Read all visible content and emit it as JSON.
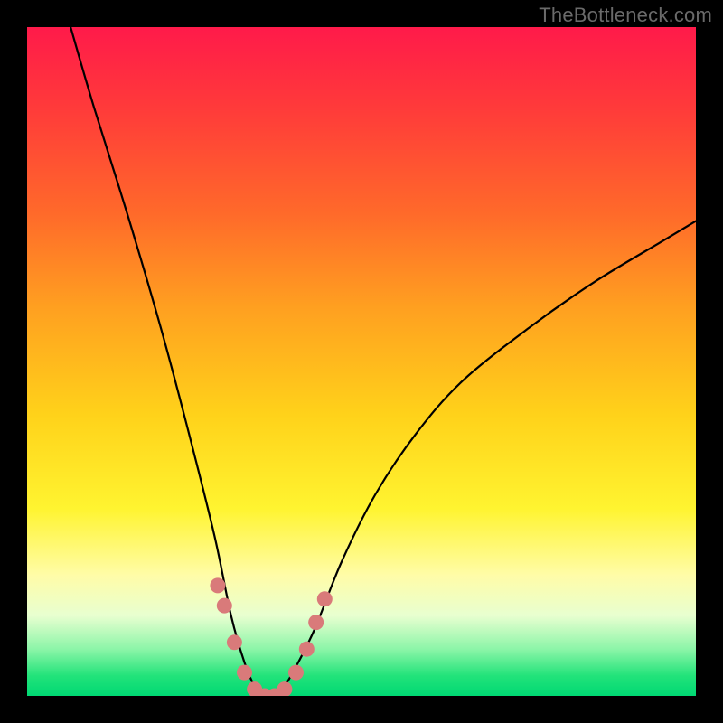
{
  "watermark": "TheBottleneck.com",
  "chart_data": {
    "type": "line",
    "title": "",
    "xlabel": "",
    "ylabel": "",
    "xlim": [
      0,
      1
    ],
    "ylim": [
      0,
      1
    ],
    "legend": false,
    "grid": false,
    "series": [
      {
        "name": "bottleneck-curve",
        "x": [
          0.065,
          0.1,
          0.15,
          0.2,
          0.24,
          0.28,
          0.305,
          0.325,
          0.34,
          0.355,
          0.37,
          0.385,
          0.4,
          0.43,
          0.47,
          0.52,
          0.58,
          0.65,
          0.75,
          0.85,
          0.95,
          1.0
        ],
        "y": [
          1.0,
          0.88,
          0.72,
          0.55,
          0.4,
          0.24,
          0.12,
          0.05,
          0.015,
          0.0,
          0.0,
          0.015,
          0.04,
          0.1,
          0.2,
          0.3,
          0.39,
          0.47,
          0.55,
          0.62,
          0.68,
          0.71
        ]
      }
    ],
    "markers": {
      "name": "highlight-dots",
      "color": "#d97a7a",
      "x": [
        0.285,
        0.295,
        0.31,
        0.325,
        0.34,
        0.355,
        0.37,
        0.385,
        0.402,
        0.418,
        0.432,
        0.445
      ],
      "y": [
        0.165,
        0.135,
        0.08,
        0.035,
        0.01,
        0.0,
        0.0,
        0.01,
        0.035,
        0.07,
        0.11,
        0.145
      ]
    },
    "background_gradient": [
      "#ff1a4a",
      "#ffd21a",
      "#00d873"
    ]
  }
}
